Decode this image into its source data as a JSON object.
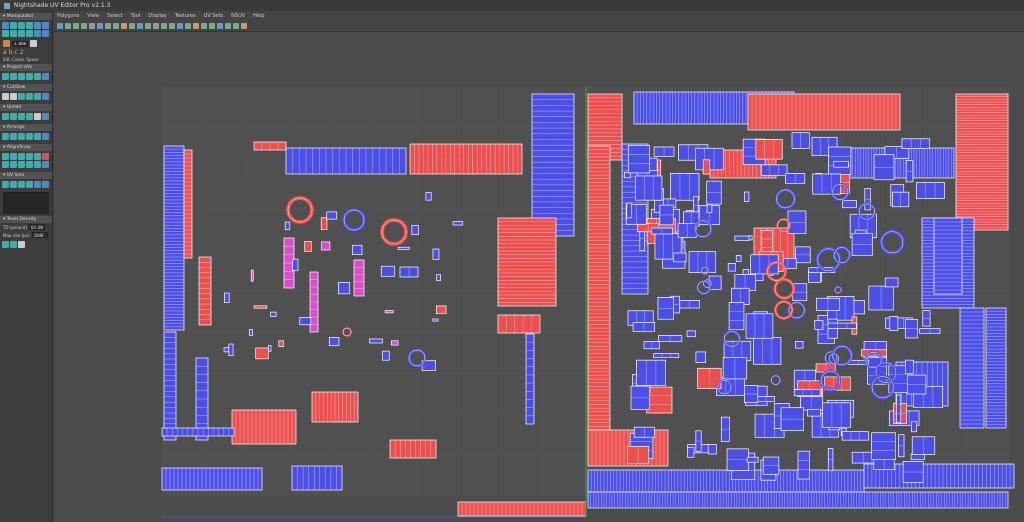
{
  "window": {
    "title": "Nightshade UV Editor Pro v2.1.3"
  },
  "menu": [
    "Polygons",
    "View",
    "Select",
    "Tool",
    "Display",
    "Textures",
    "UV Sets",
    "NSUV",
    "Help"
  ],
  "sidepanel": {
    "sections": [
      {
        "id": "manipulator",
        "label": "Manipulator"
      },
      {
        "id": "project_uvs",
        "label": "Project UVs"
      },
      {
        "id": "cut_sew",
        "label": "Cut/Sew"
      },
      {
        "id": "unfold",
        "label": "Unfold"
      },
      {
        "id": "arrange",
        "label": "Arrange"
      },
      {
        "id": "align_snap",
        "label": "Align/Snap"
      },
      {
        "id": "uv_sets",
        "label": "UV Sets"
      },
      {
        "id": "texel_density",
        "label": "Texel Density"
      }
    ],
    "manipulator_value": "1.0000",
    "abc_labels": [
      "a",
      "b",
      "c",
      "2"
    ],
    "edit_mode_text": "Edt. Comp. Space",
    "td_label": "TD (px/unit)",
    "td_value": "64.00",
    "map_size_label": "Map size (px)",
    "map_size_value": "2048"
  },
  "colors": {
    "background": "#4b4b4b",
    "grid_light": "#575757",
    "uv_blue": "#4b4fe6",
    "uv_red": "#e9504f",
    "uv_pink": "#d850c9",
    "wire": "#ffffff",
    "divider_green": "#3aa84a"
  }
}
